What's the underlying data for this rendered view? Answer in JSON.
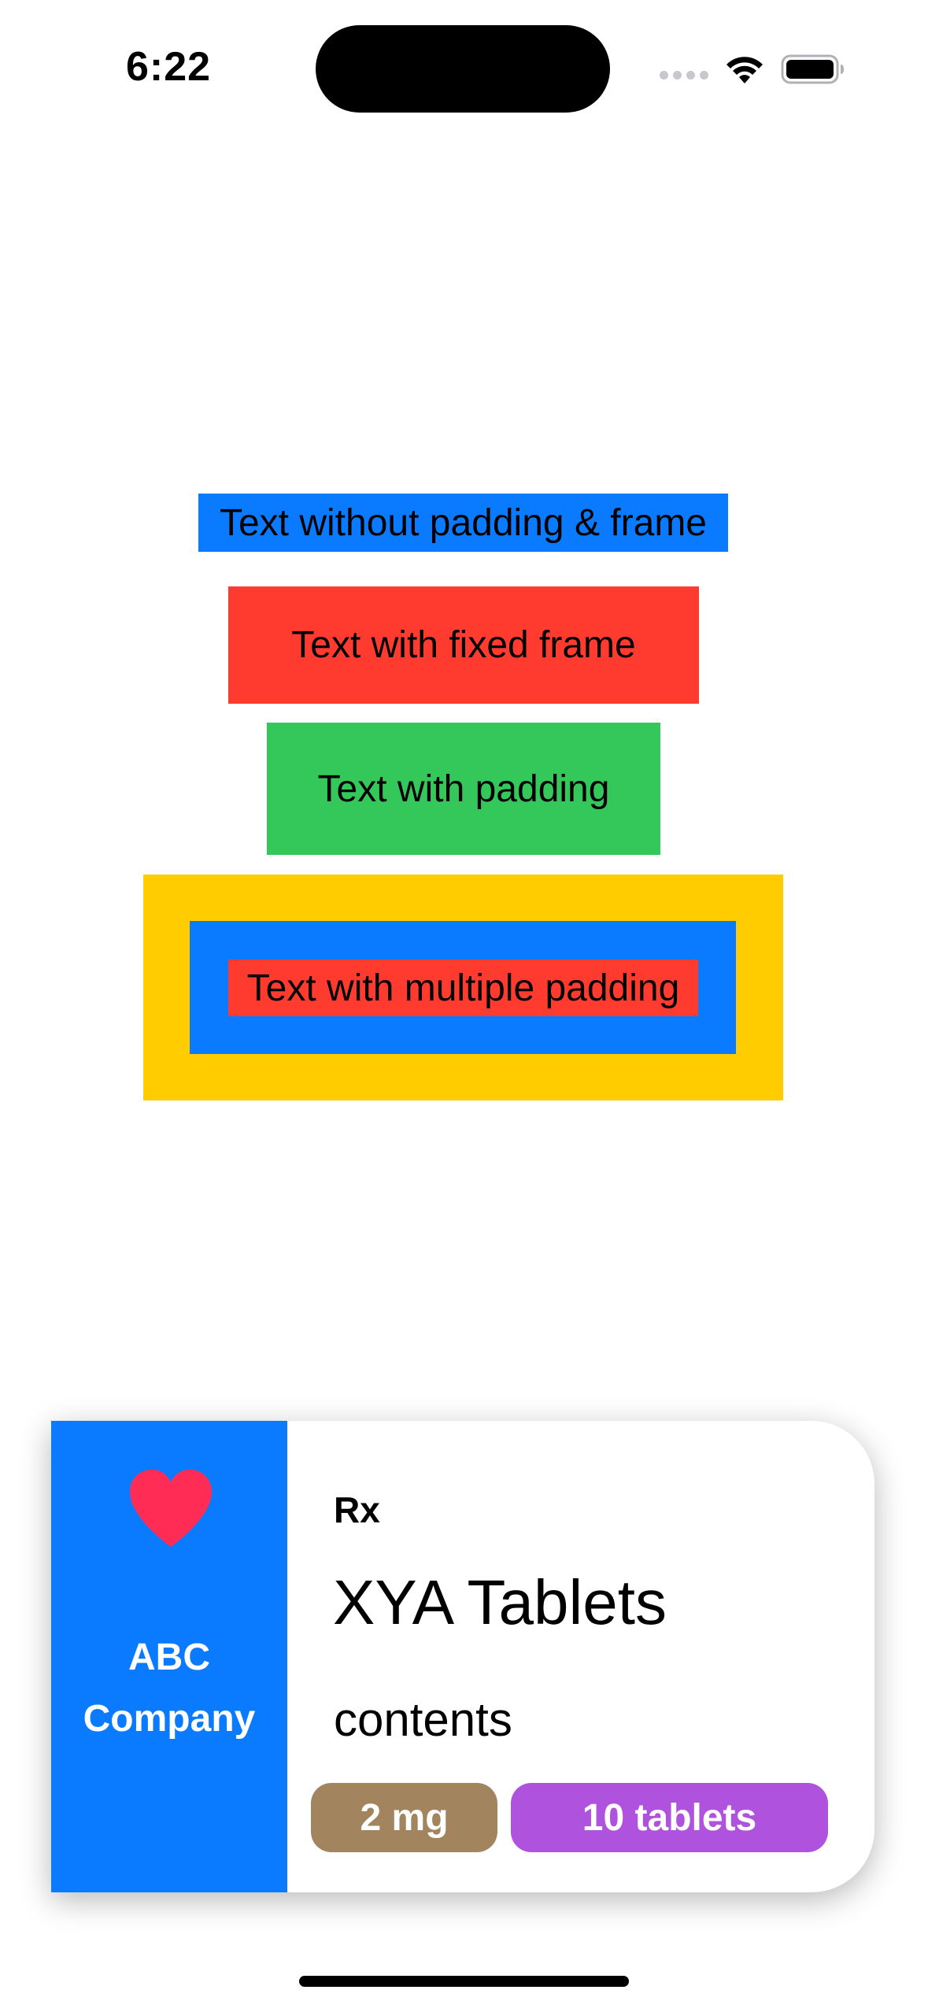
{
  "status_bar": {
    "time": "6:22",
    "icons": [
      "cellular-signal-icon",
      "wifi-icon",
      "battery-icon"
    ]
  },
  "padding_demo": {
    "no_padding_label": "Text without padding & frame",
    "fixed_frame_label": "Text with fixed frame",
    "padding_label": "Text with padding",
    "multiple_padding_label": "Text with multiple padding",
    "colors": {
      "blue": "#0a7aff",
      "red": "#ff3b30",
      "green": "#34c759",
      "yellow": "#ffcc00"
    }
  },
  "medicine_card": {
    "icon": "heart-icon",
    "company": "ABC\nCompany",
    "rx_label": "Rx",
    "drug_name": "XYA Tablets",
    "contents_label": "contents",
    "dose_badge": "2 mg",
    "count_badge": "10 tablets",
    "colors": {
      "side": "#0a7aff",
      "heart": "#ff2d55",
      "dose_badge": "#a2845e",
      "count_badge": "#af52de"
    }
  }
}
